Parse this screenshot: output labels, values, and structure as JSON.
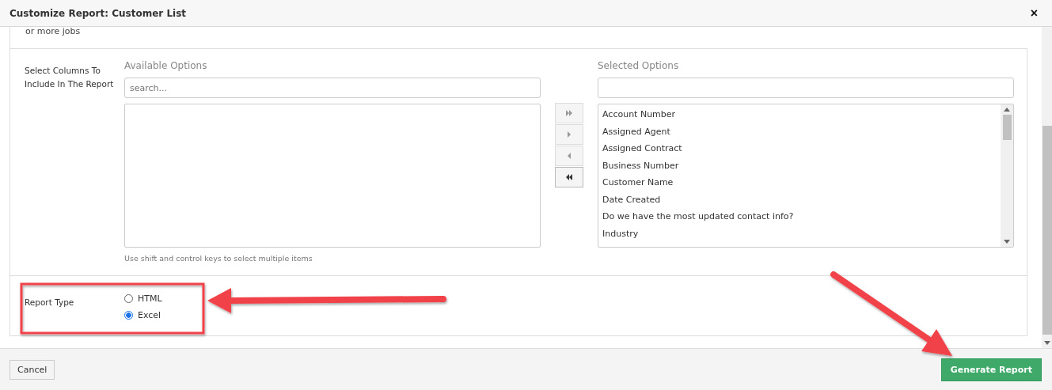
{
  "window": {
    "title": "Customize Report: Customer List",
    "close": "×"
  },
  "clipped_text": "or more jobs",
  "columns_section": {
    "label": "Select Columns To Include In The Report",
    "available": {
      "heading": "Available Options",
      "placeholder": "search...",
      "hint": "Use shift and control keys to select multiple items"
    },
    "move_buttons": [
      {
        "kind": "all-right"
      },
      {
        "kind": "right"
      },
      {
        "kind": "left"
      },
      {
        "kind": "all-left"
      }
    ],
    "selected": {
      "heading": "Selected Options",
      "items": [
        "Account Number",
        "Assigned Agent",
        "Assigned Contract",
        "Business Number",
        "Customer Name",
        "Date Created",
        "Do we have the most updated contact info?",
        "Industry"
      ]
    }
  },
  "report_type": {
    "label": "Report Type",
    "options": [
      {
        "label": "HTML",
        "selected": false
      },
      {
        "label": "Excel",
        "selected": true
      }
    ]
  },
  "buttons": {
    "cancel": "Cancel",
    "generate": "Generate Report"
  }
}
